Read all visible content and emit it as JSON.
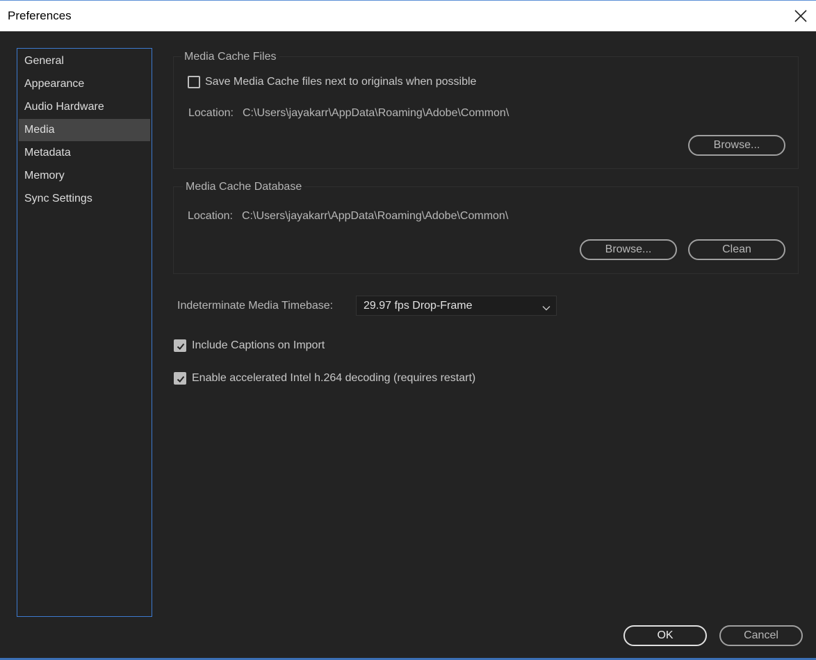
{
  "window": {
    "title": "Preferences"
  },
  "sidebar": {
    "items": [
      {
        "label": "General"
      },
      {
        "label": "Appearance"
      },
      {
        "label": "Audio Hardware"
      },
      {
        "label": "Media"
      },
      {
        "label": "Metadata"
      },
      {
        "label": "Memory"
      },
      {
        "label": "Sync Settings"
      }
    ],
    "active": "Media"
  },
  "media_cache_files": {
    "title": "Media Cache Files",
    "save_next_to_originals_label": "Save Media Cache files next to originals when possible",
    "save_next_to_originals_checked": false,
    "location_label": "Location:",
    "location_value": "C:\\Users\\jayakarr\\AppData\\Roaming\\Adobe\\Common\\",
    "browse_label": "Browse..."
  },
  "media_cache_database": {
    "title": "Media Cache Database",
    "location_label": "Location:",
    "location_value": "C:\\Users\\jayakarr\\AppData\\Roaming\\Adobe\\Common\\",
    "browse_label": "Browse...",
    "clean_label": "Clean"
  },
  "timebase": {
    "label": "Indeterminate Media Timebase:",
    "value": "29.97 fps Drop-Frame"
  },
  "options": {
    "include_captions_label": "Include Captions on Import",
    "include_captions_checked": true,
    "accelerated_decoding_label": "Enable accelerated Intel h.264 decoding (requires restart)",
    "accelerated_decoding_checked": true
  },
  "footer": {
    "ok_label": "OK",
    "cancel_label": "Cancel"
  },
  "colors": {
    "accent": "#3d7ad0",
    "background": "#232323",
    "selected_item": "#454545"
  },
  "icons": {
    "close": "close-icon",
    "dropdown": "chevron-down-icon",
    "check": "checkmark-icon"
  }
}
